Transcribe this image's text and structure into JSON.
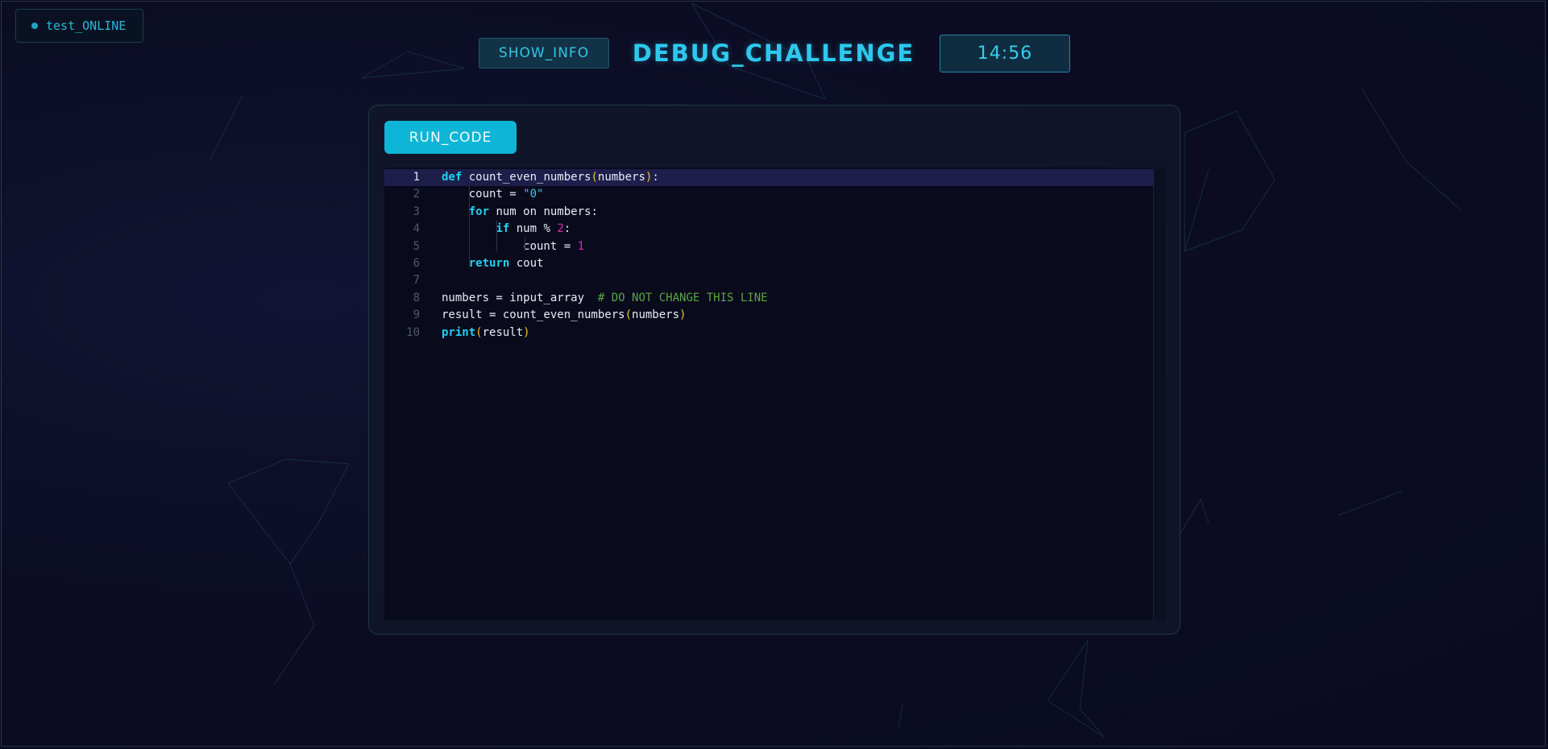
{
  "status": {
    "label": "test_ONLINE"
  },
  "header": {
    "show_info_label": "SHOW_INFO",
    "title": "DEBUG_CHALLENGE",
    "timer": "14:56"
  },
  "editor": {
    "run_label": "RUN_CODE",
    "active_line": 1,
    "lines": [
      {
        "n": "1",
        "segments": [
          [
            "kw",
            "def"
          ],
          [
            "t",
            " count_even_numbers"
          ],
          [
            "pn",
            "("
          ],
          [
            "t",
            "numbers"
          ],
          [
            "pn",
            ")"
          ],
          [
            "t",
            ":"
          ]
        ]
      },
      {
        "n": "2",
        "segments": [
          [
            "t",
            "    count = "
          ],
          [
            "str",
            "\"0\""
          ]
        ]
      },
      {
        "n": "3",
        "segments": [
          [
            "t",
            "    "
          ],
          [
            "kw",
            "for"
          ],
          [
            "t",
            " num on numbers:"
          ]
        ]
      },
      {
        "n": "4",
        "segments": [
          [
            "t",
            "        "
          ],
          [
            "kw",
            "if"
          ],
          [
            "t",
            " num % "
          ],
          [
            "num",
            "2"
          ],
          [
            "t",
            ":"
          ]
        ]
      },
      {
        "n": "5",
        "segments": [
          [
            "t",
            "            count = "
          ],
          [
            "num",
            "1"
          ]
        ]
      },
      {
        "n": "6",
        "segments": [
          [
            "t",
            "    "
          ],
          [
            "kw",
            "return"
          ],
          [
            "t",
            " cout"
          ]
        ]
      },
      {
        "n": "7",
        "segments": []
      },
      {
        "n": "8",
        "segments": [
          [
            "t",
            "numbers = input_array  "
          ],
          [
            "cm",
            "# DO NOT CHANGE THIS LINE"
          ]
        ]
      },
      {
        "n": "9",
        "segments": [
          [
            "t",
            "result = count_even_numbers"
          ],
          [
            "pn",
            "("
          ],
          [
            "t",
            "numbers"
          ],
          [
            "pn",
            ")"
          ]
        ]
      },
      {
        "n": "10",
        "segments": [
          [
            "kw",
            "print"
          ],
          [
            "pn",
            "("
          ],
          [
            "t",
            "result"
          ],
          [
            "pn",
            ")"
          ]
        ]
      }
    ]
  },
  "colors": {
    "accent": "#0fb5d6",
    "keyword": "#1fd2f0",
    "number": "#e426b8",
    "paren": "#f0c330",
    "comment": "#59a640"
  }
}
